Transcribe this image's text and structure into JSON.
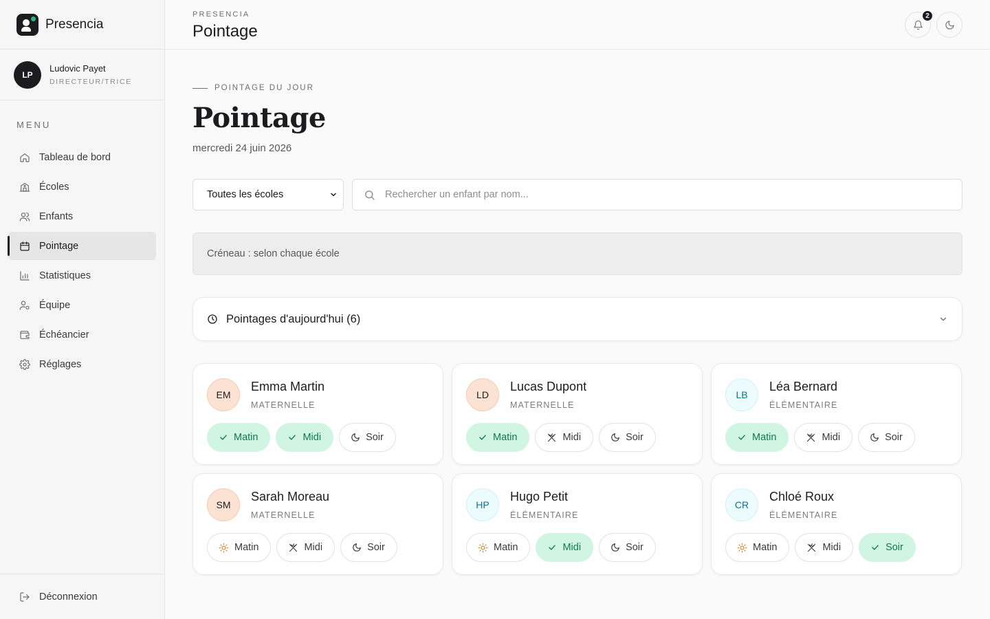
{
  "app": {
    "name": "Presencia"
  },
  "user": {
    "initials": "LP",
    "name": "Ludovic Payet",
    "role": "DIRECTEUR/TRICE"
  },
  "sidebar": {
    "menu_label": "MENU",
    "items": [
      {
        "label": "Tableau de bord",
        "icon": "home-icon"
      },
      {
        "label": "Écoles",
        "icon": "school-icon"
      },
      {
        "label": "Enfants",
        "icon": "users-icon"
      },
      {
        "label": "Pointage",
        "icon": "calendar-icon",
        "active": true
      },
      {
        "label": "Statistiques",
        "icon": "bar-chart-icon"
      },
      {
        "label": "Équipe",
        "icon": "user-gear-icon"
      },
      {
        "label": "Échéancier",
        "icon": "wallet-icon"
      },
      {
        "label": "Réglages",
        "icon": "gear-icon"
      }
    ],
    "logout_label": "Déconnexion"
  },
  "header": {
    "eyebrow": "PRESENCIA",
    "title": "Pointage",
    "notifications_count": "2"
  },
  "main": {
    "eyebrow": "POINTAGE DU JOUR",
    "title": "Pointage",
    "date": "mercredi 24 juin 2026",
    "school_filter": {
      "selected": "Toutes les écoles"
    },
    "search": {
      "placeholder": "Rechercher un enfant par nom...",
      "value": ""
    },
    "slot_text": "Créneau : selon chaque école",
    "today_label": "Pointages d'aujourd'hui (6)"
  },
  "children": [
    {
      "initials": "EM",
      "name": "Emma Martin",
      "level": "MATERNELLE",
      "kind": "mat",
      "slots": [
        {
          "label": "Matin",
          "on": true,
          "icon": "check-icon"
        },
        {
          "label": "Midi",
          "on": true,
          "icon": "check-icon"
        },
        {
          "label": "Soir",
          "on": false,
          "icon": "moon-icon"
        }
      ]
    },
    {
      "initials": "LD",
      "name": "Lucas Dupont",
      "level": "MATERNELLE",
      "kind": "mat",
      "slots": [
        {
          "label": "Matin",
          "on": true,
          "icon": "check-icon"
        },
        {
          "label": "Midi",
          "on": false,
          "icon": "utensils-icon"
        },
        {
          "label": "Soir",
          "on": false,
          "icon": "moon-icon"
        }
      ]
    },
    {
      "initials": "LB",
      "name": "Léa Bernard",
      "level": "ÉLÉMENTAIRE",
      "kind": "ele",
      "slots": [
        {
          "label": "Matin",
          "on": true,
          "icon": "check-icon"
        },
        {
          "label": "Midi",
          "on": false,
          "icon": "utensils-icon"
        },
        {
          "label": "Soir",
          "on": false,
          "icon": "moon-icon"
        }
      ]
    },
    {
      "initials": "SM",
      "name": "Sarah Moreau",
      "level": "MATERNELLE",
      "kind": "mat",
      "slots": [
        {
          "label": "Matin",
          "on": false,
          "icon": "sun-icon"
        },
        {
          "label": "Midi",
          "on": false,
          "icon": "utensils-icon"
        },
        {
          "label": "Soir",
          "on": false,
          "icon": "moon-icon"
        }
      ]
    },
    {
      "initials": "HP",
      "name": "Hugo Petit",
      "level": "ÉLÉMENTAIRE",
      "kind": "ele",
      "slots": [
        {
          "label": "Matin",
          "on": false,
          "icon": "sun-icon"
        },
        {
          "label": "Midi",
          "on": true,
          "icon": "check-icon"
        },
        {
          "label": "Soir",
          "on": false,
          "icon": "moon-icon"
        }
      ]
    },
    {
      "initials": "CR",
      "name": "Chloé Roux",
      "level": "ÉLÉMENTAIRE",
      "kind": "ele",
      "slots": [
        {
          "label": "Matin",
          "on": false,
          "icon": "sun-icon"
        },
        {
          "label": "Midi",
          "on": false,
          "icon": "utensils-icon"
        },
        {
          "label": "Soir",
          "on": true,
          "icon": "check-icon"
        }
      ]
    }
  ],
  "colors": {
    "accent_dark": "#1c1c1e",
    "present_bg": "#d1f5e3",
    "present_text": "#107a4d",
    "maternelle_avatar": "#fbe2d3",
    "elementaire_avatar": "#ecfbfd"
  }
}
